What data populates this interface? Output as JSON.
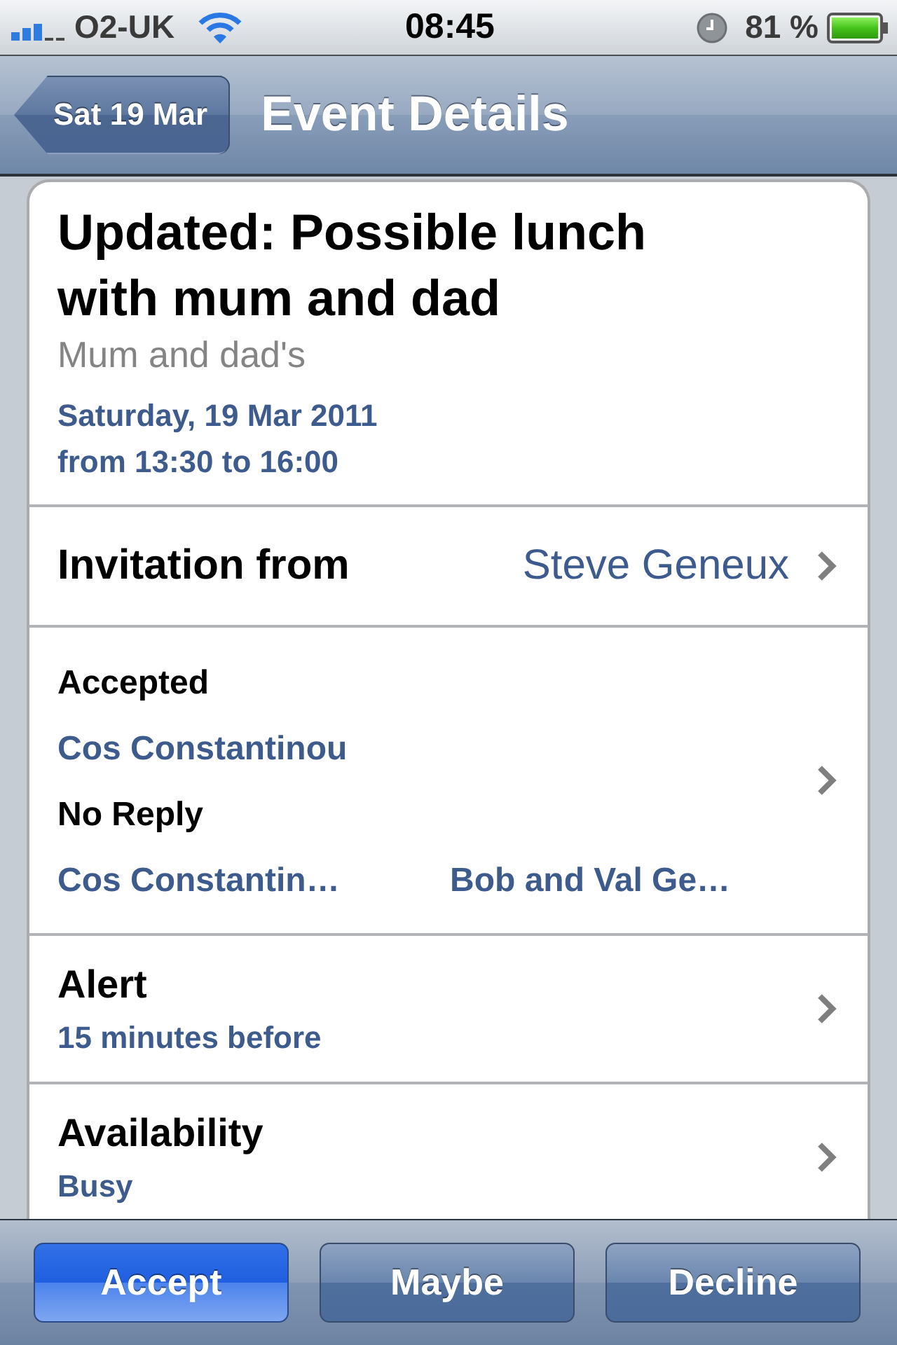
{
  "status_bar": {
    "carrier": "O2-UK",
    "time": "08:45",
    "battery": "81 %"
  },
  "nav_bar": {
    "back_button": "Sat 19 Mar",
    "title": "Event Details"
  },
  "event": {
    "title": "Updated: Possible lunch with mum and dad",
    "location": "Mum and dad's",
    "date": "Saturday, 19 Mar 2011",
    "time": "from 13:30 to 16:00"
  },
  "rows": [
    {
      "kind": "inline",
      "label": "Invitation from",
      "value": "Steve Geneux"
    },
    {
      "kind": "attendees",
      "groups": [
        {
          "label": "Accepted",
          "names": [
            "Cos Constantinou"
          ]
        },
        {
          "label": "No Reply",
          "names": [
            "Cos Constantin…",
            "Bob and Val Ge…"
          ]
        }
      ]
    },
    {
      "kind": "stacked",
      "label": "Alert",
      "value": "15 minutes before"
    },
    {
      "kind": "stacked",
      "label": "Availability",
      "value": "Busy"
    }
  ],
  "toolbar": {
    "buttons": [
      {
        "label": "Accept",
        "selected": true
      },
      {
        "label": "Maybe",
        "selected": false
      },
      {
        "label": "Decline",
        "selected": false
      }
    ]
  }
}
